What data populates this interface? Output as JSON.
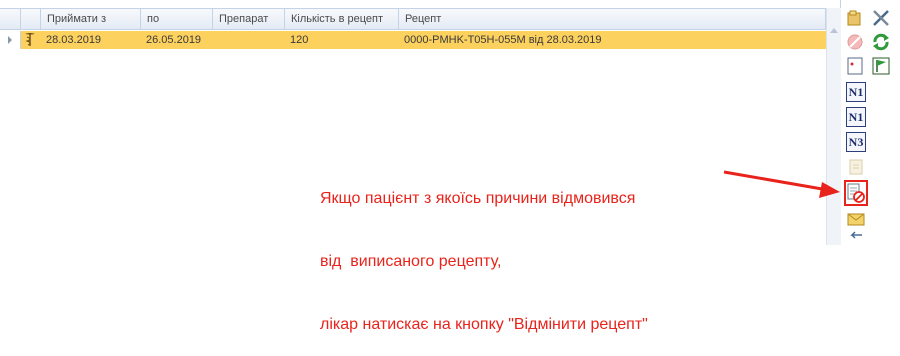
{
  "grid": {
    "columns": [
      "Приймати з",
      "по",
      "Препарат",
      "Кількість в рецепт",
      "Рецепт"
    ],
    "rows": [
      {
        "from": "28.03.2019",
        "to": "26.05.2019",
        "drug": "",
        "quantity": "120",
        "recipe": "0000-PMHK-T05H-055M від 28.03.2019"
      }
    ]
  },
  "toolbar": {
    "n_buttons": [
      "N1",
      "N1",
      "N3"
    ]
  },
  "annotation": {
    "lines": [
      "Якщо пацієнт з якоїсь причини відмовився",
      "від  виписаного рецепту,",
      "лікар натискає на кнопку \"Відмінити рецепт\""
    ],
    "color": "#e8231b"
  },
  "colors": {
    "selected_row": "#fcd15e",
    "header_border": "#c5d3e6",
    "accent_red": "#e8231b"
  }
}
